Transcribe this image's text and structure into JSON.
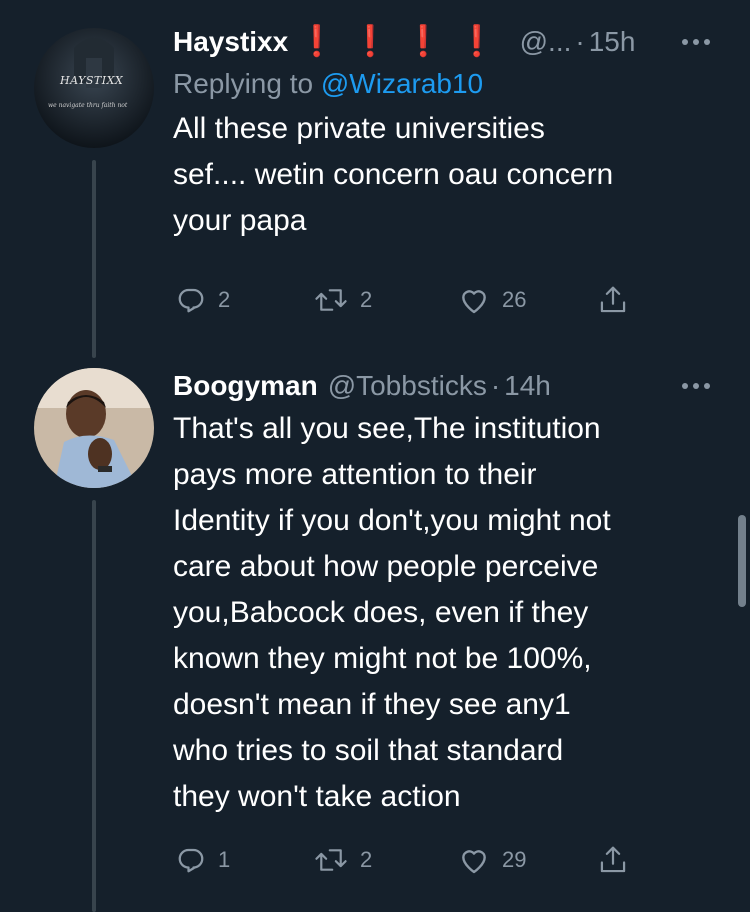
{
  "tweets": [
    {
      "name": "Haystixx",
      "marks": [
        "❗",
        "❗",
        "❗",
        "❗"
      ],
      "handle": "@...",
      "separator": "·",
      "time": "15h",
      "replying_prefix": "Replying to ",
      "replying_to": "@Wizarab10",
      "avatar_text": "HAYSTIXX",
      "avatar_subtext": "we navigate thru faith not",
      "body": "All these private universities\nsef.... wetin concern oau concern\nyour papa",
      "actions": {
        "replies": "2",
        "retweets": "2",
        "likes": "26"
      }
    },
    {
      "name": "Boogyman",
      "handle": "@Tobbsticks",
      "separator": "·",
      "time": "14h",
      "body": "That's all you see,The institution\npays more attention to their\nIdentity if you don't,you might not\ncare about how people perceive\nyou,Babcock does, even if they\nknown they might not be 100%,\ndoesn't mean if they see any1\nwho tries to soil that standard\nthey won't take action",
      "actions": {
        "replies": "1",
        "retweets": "2",
        "likes": "29"
      }
    }
  ],
  "colors": {
    "background": "#15202b",
    "muted": "#8b98a5",
    "link": "#1d9bf0",
    "exclamation": "#e0245e",
    "thread_line": "#38444d"
  },
  "icons": [
    "reply-icon",
    "retweet-icon",
    "like-icon",
    "share-icon",
    "more-icon"
  ]
}
